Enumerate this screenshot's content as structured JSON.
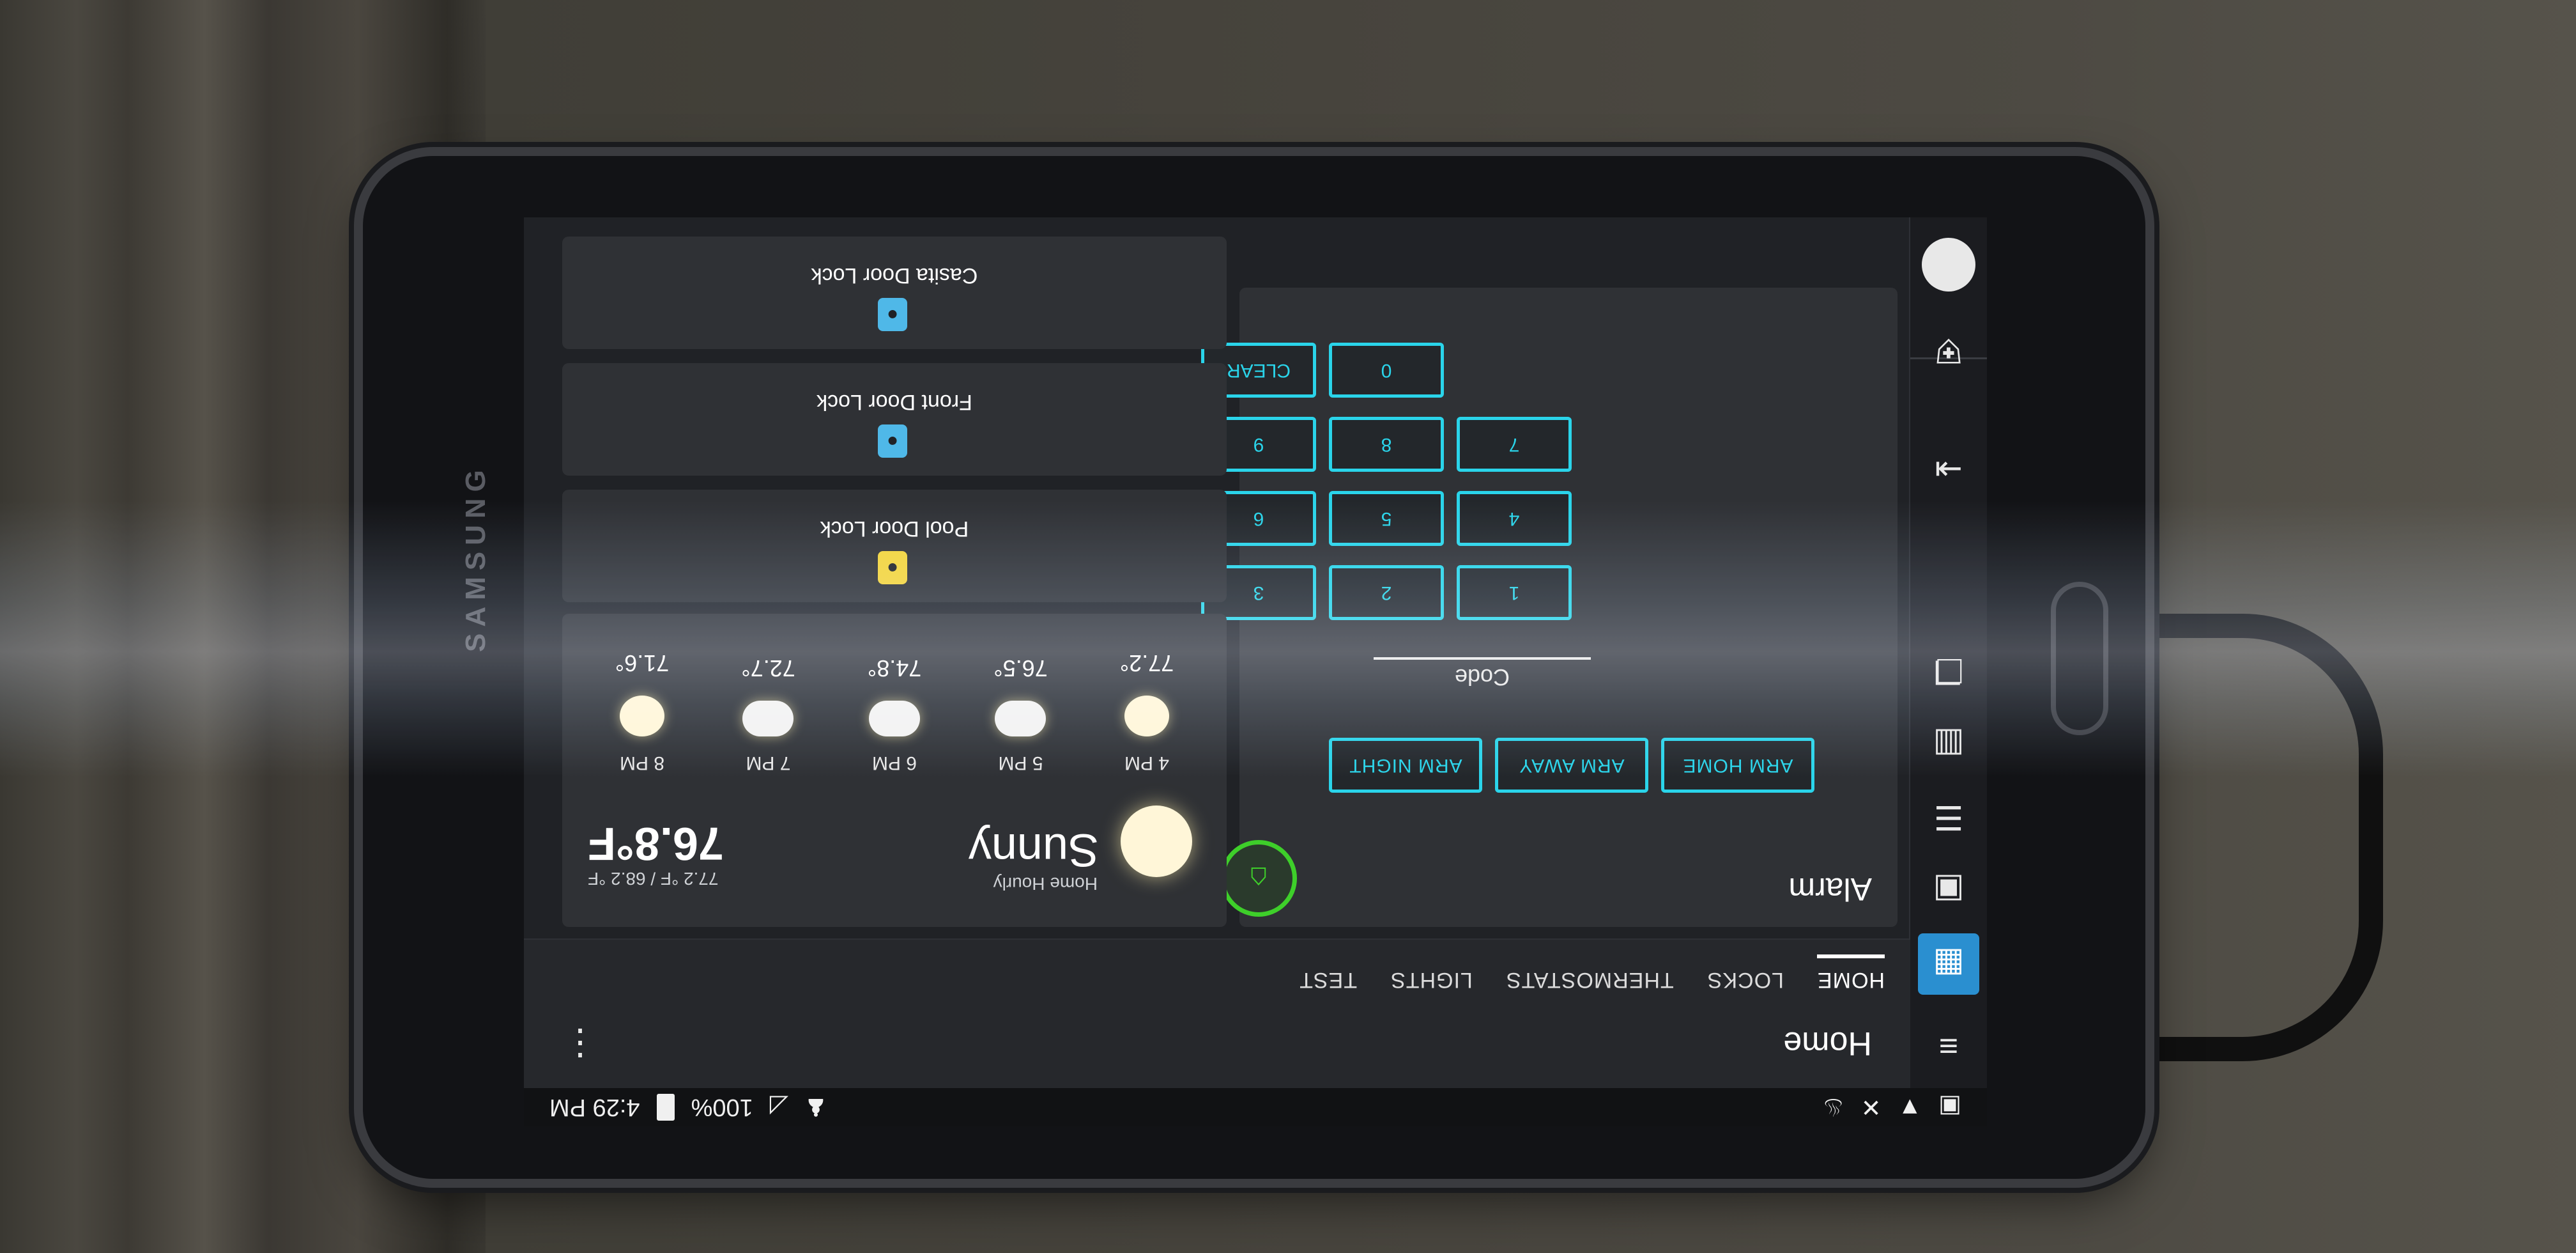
{
  "status_bar": {
    "time": "4:29 PM",
    "battery": "100%"
  },
  "header": {
    "title": "Home"
  },
  "tabs": [
    {
      "label": "HOME",
      "active": true
    },
    {
      "label": "LOCKS",
      "active": false
    },
    {
      "label": "THERMOSTATS",
      "active": false
    },
    {
      "label": "LIGHTS",
      "active": false
    },
    {
      "label": "TEST",
      "active": false
    }
  ],
  "alarm": {
    "title": "Alarm",
    "arm_home": "ARM HOME",
    "arm_away": "ARM AWAY",
    "arm_night": "ARM NIGHT",
    "code_label": "Code",
    "keys": [
      "1",
      "2",
      "3",
      "4",
      "5",
      "6",
      "7",
      "8",
      "9",
      "0",
      "CLEAR"
    ]
  },
  "weather": {
    "condition": "Sunny",
    "source": "Home Hourly",
    "temperature": "76.8°F",
    "range": "77.2 °F / 68.2 °F",
    "hourly": [
      {
        "time": "4 PM",
        "temp": "77.2°",
        "icon": "sun"
      },
      {
        "time": "5 PM",
        "temp": "76.5°",
        "icon": "cloud"
      },
      {
        "time": "6 PM",
        "temp": "74.8°",
        "icon": "cloud"
      },
      {
        "time": "7 PM",
        "temp": "72.7°",
        "icon": "cloud"
      },
      {
        "time": "8 PM",
        "temp": "71.6°",
        "icon": "moon"
      }
    ]
  },
  "locks": [
    {
      "name": "Pool Door Lock",
      "color": "#f2d43a"
    },
    {
      "name": "Front Door Lock",
      "color": "#4fb8e8"
    },
    {
      "name": "Casita Door Lock",
      "color": "#4fb8e8"
    }
  ],
  "colors": {
    "accent": "#2ad4ea",
    "alarm_ok": "#3ecf2a",
    "active_nav": "#2a8fd0"
  }
}
